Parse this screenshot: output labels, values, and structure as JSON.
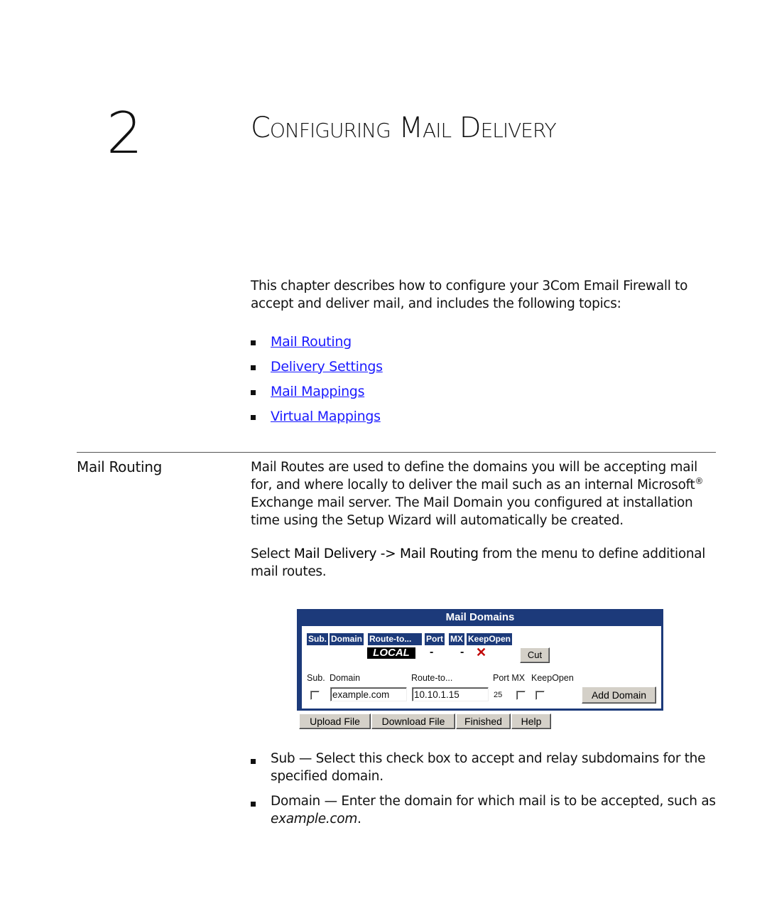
{
  "chapter": {
    "number": "2",
    "title": "Configuring Mail Delivery"
  },
  "intro": {
    "text": "This chapter describes how to configure your 3Com Email Firewall to accept and deliver mail, and includes the following topics:"
  },
  "toc": [
    {
      "label": "Mail Routing"
    },
    {
      "label": "Delivery Settings"
    },
    {
      "label": "Mail Mappings"
    },
    {
      "label": "Virtual Mappings"
    }
  ],
  "section": {
    "heading": "Mail Routing",
    "para1_main": "Mail Routes are used to define the domains you will be accepting mail for, and where locally to deliver the mail such as an internal Microsoft",
    "para1_reg": "®",
    "para1_end": " Exchange mail server. The Mail Domain you configured at installation time using the Setup Wizard will automatically be created.",
    "para2_pre": "Select ",
    "para2_menu": "Mail Delivery -> Mail Routing",
    "para2_post": " from the menu to define additional mail routes."
  },
  "widget": {
    "title": "Mail Domains",
    "headers": [
      "Sub.",
      "Domain",
      "Route-to...",
      "Port",
      "MX",
      "KeepOpen"
    ],
    "existing_row": {
      "route": "LOCAL",
      "port": "-",
      "mx": "-",
      "keepopen_icon": "x-icon",
      "cut_label": "Cut"
    },
    "form_labels": {
      "sub": "Sub.",
      "domain": "Domain",
      "route": "Route-to...",
      "port_mx": "Port MX",
      "keepopen": "KeepOpen"
    },
    "form_values": {
      "domain": "example.com",
      "route": "10.10.1.15",
      "port": "25",
      "sub_checked": false,
      "mx_checked": false,
      "keepopen_checked": false
    },
    "add_domain_label": "Add Domain",
    "colors": {
      "header_bg": "#1c3a7a",
      "x_color": "#c00000"
    }
  },
  "bottom_buttons": [
    "Upload File",
    "Download File",
    "Finished",
    "Help"
  ],
  "bullets": [
    {
      "term": "Sub",
      "text": " — Select this check box to accept and relay subdomains for the specified domain."
    },
    {
      "term": "Domain",
      "text": " — Enter the domain for which mail is to be accepted, such as ",
      "example": "example.com",
      "end": "."
    }
  ]
}
